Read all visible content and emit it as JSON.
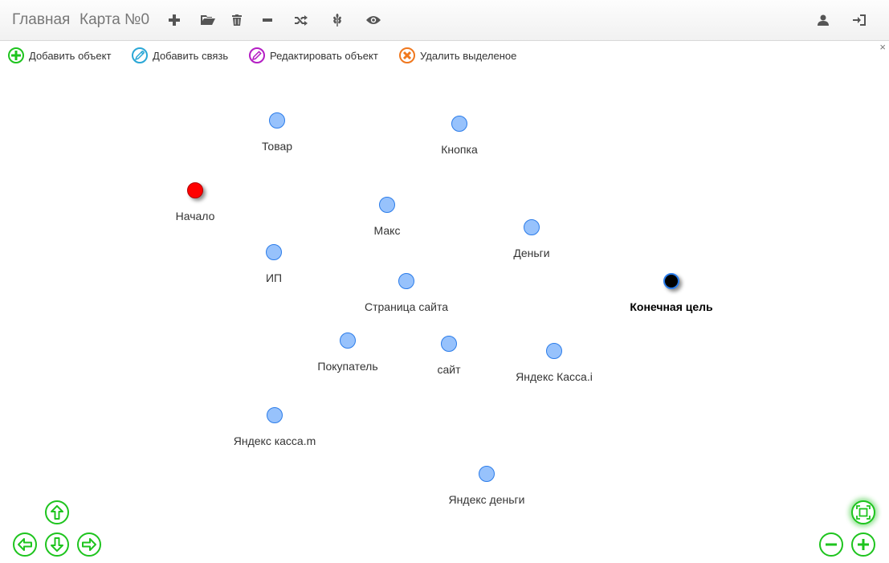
{
  "navbar": {
    "home_label": "Главная",
    "map_title": "Карта №0",
    "icons": [
      "plus-icon",
      "folder-open-icon",
      "trash-icon",
      "minus-icon",
      "shuffle-icon",
      "grain-icon",
      "eye-icon",
      "user-icon",
      "log-in-icon"
    ]
  },
  "toolbar": {
    "add_object": "Добавить объект",
    "add_link": "Добавить связь",
    "edit_object": "Редактировать объект",
    "delete_selected": "Удалить выделеное",
    "close_glyph": "×"
  },
  "nodes": [
    {
      "label": "Товар",
      "kind": "normal"
    },
    {
      "label": "Кнопка",
      "kind": "normal"
    },
    {
      "label": "Начало",
      "kind": "start"
    },
    {
      "label": "Макс",
      "kind": "normal"
    },
    {
      "label": "Деньги",
      "kind": "normal"
    },
    {
      "label": "ИП",
      "kind": "normal"
    },
    {
      "label": "Страница сайта",
      "kind": "normal"
    },
    {
      "label": "Конечная цель",
      "kind": "goal"
    },
    {
      "label": "Покупатель",
      "kind": "normal"
    },
    {
      "label": "сайт",
      "kind": "normal"
    },
    {
      "label": "Яндекс Касса.i",
      "kind": "normal"
    },
    {
      "label": "Яндекс касса.m",
      "kind": "normal"
    },
    {
      "label": "Яндекс деньги",
      "kind": "normal"
    }
  ],
  "colors": {
    "node_fill": "#97c2fc",
    "node_border": "#2b7ce9",
    "start_fill": "#ff0000",
    "goal_fill": "#000000",
    "control_green": "#1ec41e",
    "add_object_color": "#1ec41e",
    "add_link_color": "#2aa7d6",
    "edit_color": "#b41ec4",
    "delete_color": "#f0781e"
  },
  "controls": [
    "pan-up-icon",
    "pan-left-icon",
    "pan-down-icon",
    "pan-right-icon",
    "zoom-fit-icon",
    "zoom-out-icon",
    "zoom-in-icon"
  ]
}
